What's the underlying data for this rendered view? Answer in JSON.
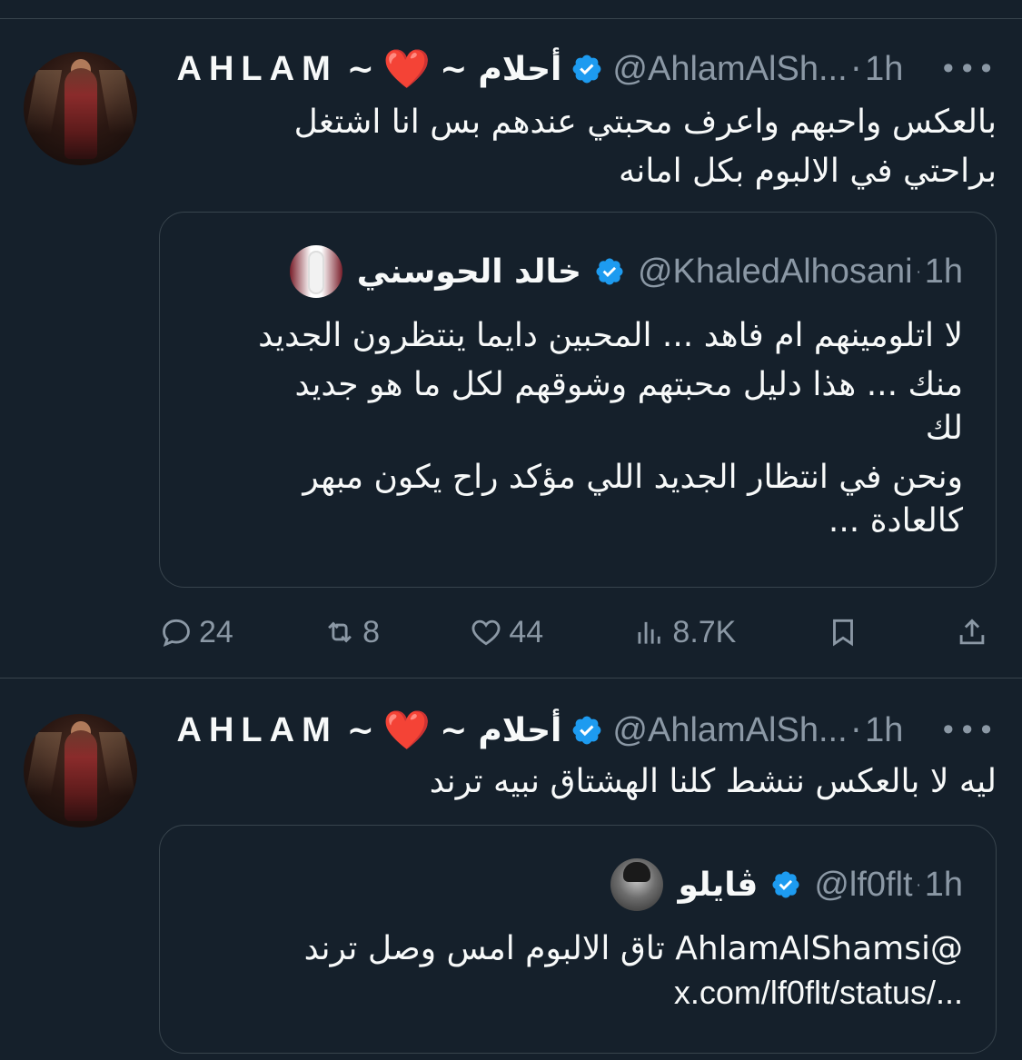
{
  "tweets": [
    {
      "author": {
        "latin_name": "AHLAM",
        "sep1": "~",
        "heart": "❤️",
        "sep2": "~",
        "arabic_name": "أحلام",
        "handle": "@AhlamAlSh...",
        "time": "1h",
        "verified_color": "#1d9bf0"
      },
      "text_lines": [
        "بالعكس واحبهم واعرف محبتي عندهم بس انا اشتغل",
        "براحتي في الالبوم بكل امانه"
      ],
      "quote": {
        "name": "خالد الحوسني",
        "handle": "@KhaledAlhosani",
        "time": "1h",
        "text_lines": [
          "لا اتلومينهم ام فاهد ... المحبين دايما ينتظرون الجديد",
          "منك ... هذا دليل محبتهم وشوقهم لكل ما هو جديد",
          "لك",
          "ونحن في انتظار الجديد اللي مؤكد راح يكون مبهر",
          "كالعادة ..."
        ]
      },
      "actions": {
        "replies": "24",
        "retweets": "8",
        "likes": "44",
        "views": "8.7K"
      }
    },
    {
      "author": {
        "latin_name": "AHLAM",
        "sep1": "~",
        "heart": "❤️",
        "sep2": "~",
        "arabic_name": "أحلام",
        "handle": "@AhlamAlSh...",
        "time": "1h",
        "verified_color": "#1d9bf0"
      },
      "text_lines": [
        "ليه لا بالعكس ننشط كلنا الهشتاق نبيه ترند"
      ],
      "quote": {
        "name": "ڤايلو",
        "handle": "@lf0flt",
        "time": "1h",
        "text_lines": [
          "@AhlamAlShamsi تاق الالبوم امس وصل ترند",
          "x.com/lf0flt/status/..."
        ]
      }
    }
  ],
  "dot": "·",
  "more": "•••"
}
